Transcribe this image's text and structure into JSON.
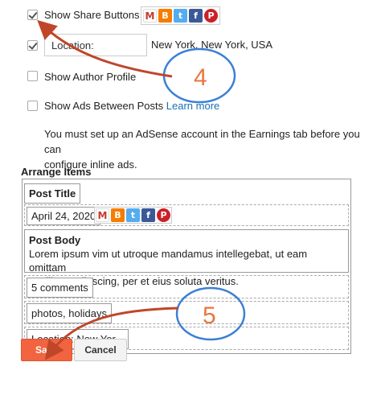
{
  "options": {
    "share_buttons": {
      "label": "Show Share Buttons",
      "checked": true
    },
    "location": {
      "input_label": "Location:",
      "value": "New York, New York, USA",
      "checked": true
    },
    "author_profile": {
      "label": "Show Author Profile",
      "checked": false
    },
    "ads": {
      "label": "Show Ads Between Posts",
      "link": "Learn more",
      "checked": false
    }
  },
  "adsense_note": {
    "line1": "You must set up an AdSense account in the Earnings tab before you can",
    "line2": "configure inline ads."
  },
  "arrange": {
    "heading": "Arrange Items",
    "post_title": "Post Title",
    "date": "April 24, 2020",
    "post_body_title": "Post Body",
    "post_body_text_line1": "Lorem ipsum vim ut utroque mandamus intellegebat, ut eam omittam",
    "post_body_text_line2": "ancillae sadipscing, per et eius soluta veritus.",
    "comments": "5 comments",
    "labels": "photos, holidays",
    "location": "Location: New Yor..."
  },
  "buttons": {
    "save": "Save",
    "cancel": "Cancel"
  },
  "annotations": {
    "step4": "4",
    "step5": "5"
  },
  "colors": {
    "accent": "#f2643f",
    "annotation_arrow": "#c0462a",
    "annotation_circle": "#3b7fd4",
    "annotation_number": "#e8763f"
  },
  "icons": [
    "gmail-icon",
    "blogger-icon",
    "twitter-icon",
    "facebook-icon",
    "pinterest-icon"
  ]
}
